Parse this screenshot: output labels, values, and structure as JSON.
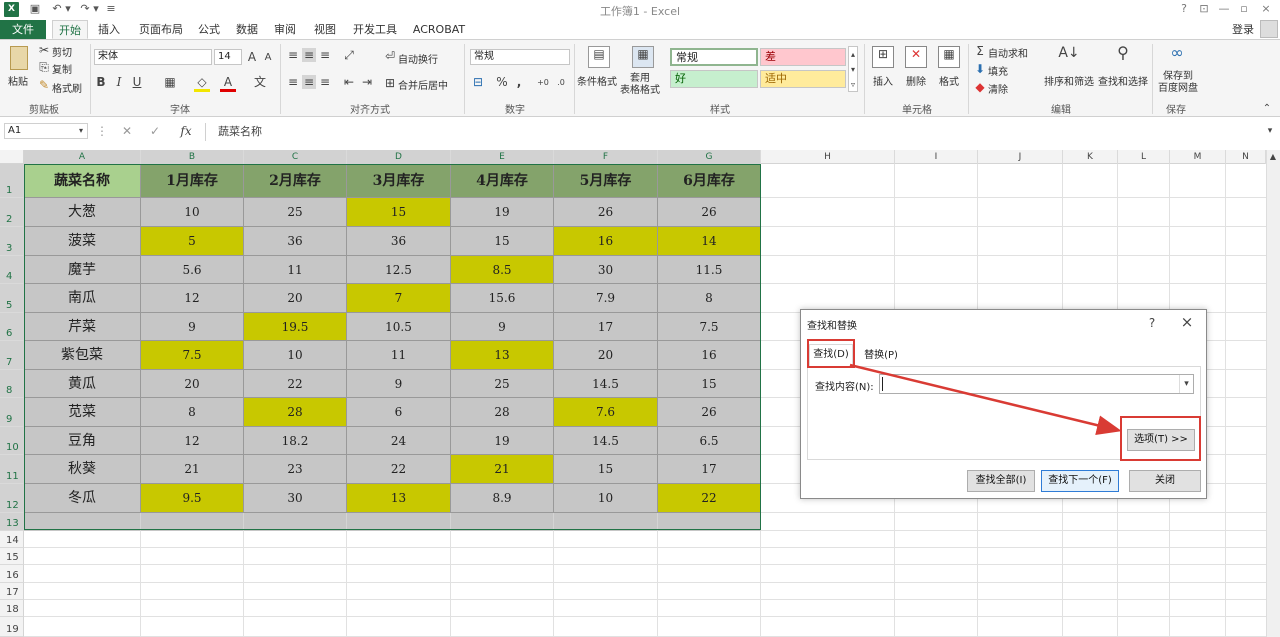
{
  "titlebar": {
    "title": "工作簿1 - Excel",
    "help": "?",
    "minimize": "—",
    "restore": "▫",
    "close": "×"
  },
  "tabs": [
    "文件",
    "开始",
    "插入",
    "页面布局",
    "公式",
    "数据",
    "审阅",
    "视图",
    "开发工具",
    "ACROBAT"
  ],
  "signin": "登录",
  "ribbon": {
    "clipboard": {
      "paste": "粘贴",
      "cut": "剪切",
      "copy": "复制",
      "format_painter": "格式刷",
      "label": "剪贴板"
    },
    "font": {
      "name": "宋体",
      "size": "14",
      "bold": "B",
      "italic": "I",
      "underline": "U",
      "label": "字体"
    },
    "alignment": {
      "wrap": "自动换行",
      "merge": "合并后居中",
      "label": "对齐方式"
    },
    "number": {
      "format": "常规",
      "percent": "%",
      "comma": ",",
      "label": "数字"
    },
    "styles": {
      "conditional": "条件格式",
      "table": "套用\n表格格式",
      "normal": "常规",
      "bad": "差",
      "good": "好",
      "neutral": "适中",
      "label": "样式"
    },
    "cells": {
      "insert": "插入",
      "delete": "删除",
      "format": "格式",
      "label": "单元格"
    },
    "editing": {
      "autosum": "自动求和",
      "fill": "填充",
      "clear": "清除",
      "sort": "排序和筛选",
      "find": "查找和选择",
      "label": "编辑"
    },
    "save": {
      "save_to": "保存到\n百度网盘",
      "label": "保存"
    }
  },
  "formula_bar": {
    "name_box": "A1",
    "fx": "fx",
    "content": "蔬菜名称"
  },
  "columns": [
    "A",
    "B",
    "C",
    "D",
    "E",
    "F",
    "G",
    "H",
    "I",
    "J",
    "K",
    "L",
    "M",
    "N"
  ],
  "rows": [
    "1",
    "2",
    "3",
    "4",
    "5",
    "6",
    "7",
    "8",
    "9",
    "10",
    "11",
    "12",
    "13",
    "14",
    "15",
    "16",
    "17",
    "18",
    "19"
  ],
  "table": {
    "headers": [
      "蔬菜名称",
      "1月库存",
      "2月库存",
      "3月库存",
      "4月库存",
      "5月库存",
      "6月库存"
    ],
    "rows": [
      [
        "大葱",
        "10",
        "25",
        "15",
        "19",
        "26",
        "26"
      ],
      [
        "菠菜",
        "5",
        "36",
        "36",
        "15",
        "16",
        "14"
      ],
      [
        "魔芋",
        "5.6",
        "11",
        "12.5",
        "8.5",
        "30",
        "11.5"
      ],
      [
        "南瓜",
        "12",
        "20",
        "7",
        "15.6",
        "7.9",
        "8"
      ],
      [
        "芹菜",
        "9",
        "19.5",
        "10.5",
        "9",
        "17",
        "7.5"
      ],
      [
        "紫包菜",
        "7.5",
        "10",
        "11",
        "13",
        "20",
        "16"
      ],
      [
        "黄瓜",
        "20",
        "22",
        "9",
        "25",
        "14.5",
        "15"
      ],
      [
        "苋菜",
        "8",
        "28",
        "6",
        "28",
        "7.6",
        "26"
      ],
      [
        "豆角",
        "12",
        "18.2",
        "24",
        "19",
        "14.5",
        "6.5"
      ],
      [
        "秋葵",
        "21",
        "23",
        "22",
        "21",
        "15",
        "17"
      ],
      [
        "冬瓜",
        "9.5",
        "30",
        "13",
        "8.9",
        "10",
        "22"
      ]
    ],
    "highlights": [
      [
        0,
        3
      ],
      [
        1,
        1
      ],
      [
        1,
        5
      ],
      [
        1,
        6
      ],
      [
        2,
        4
      ],
      [
        3,
        3
      ],
      [
        4,
        2
      ],
      [
        5,
        1
      ],
      [
        5,
        4
      ],
      [
        7,
        2
      ],
      [
        7,
        5
      ],
      [
        9,
        4
      ],
      [
        10,
        1
      ],
      [
        10,
        3
      ],
      [
        10,
        6
      ]
    ],
    "colors": {
      "header_bg": "#84a36b",
      "first_header_bg": "#a9d08e",
      "cell_bg": "#c6c6c6",
      "highlight": "#c8c800"
    }
  },
  "dialog": {
    "title": "查找和替换",
    "help": "?",
    "close": "×",
    "tab_find": "查找(D)",
    "tab_replace": "替换(P)",
    "find_label": "查找内容(N):",
    "find_value": "",
    "options_button": "选项(T) >>",
    "find_all": "查找全部(I)",
    "find_next": "查找下一个(F)",
    "close_button": "关闭"
  }
}
